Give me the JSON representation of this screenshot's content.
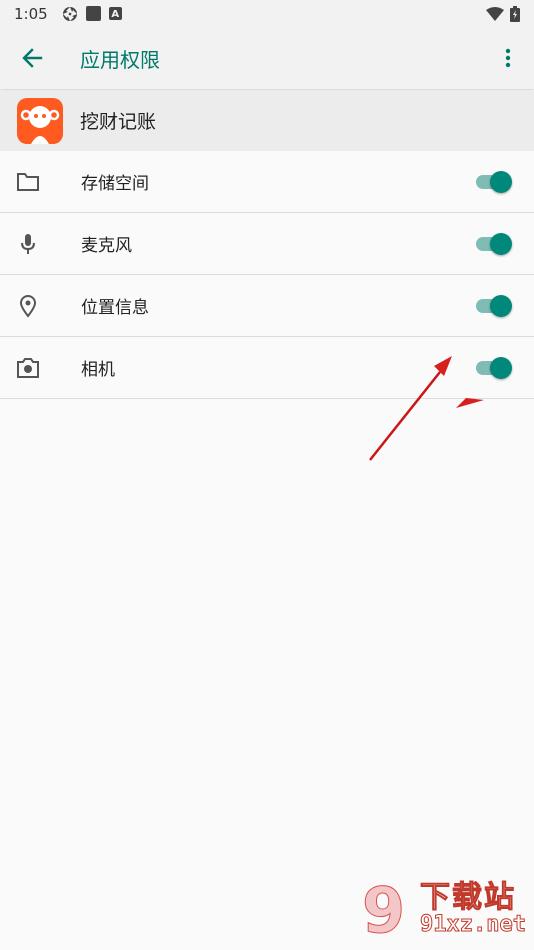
{
  "status_bar": {
    "time": "1:05",
    "icons": [
      "aperture-icon",
      "square-notification-icon",
      "a-notification-icon",
      "wifi-icon",
      "battery-icon"
    ]
  },
  "app_bar": {
    "back_icon": "arrow-back-icon",
    "title": "应用权限",
    "menu_icon": "more-vert-icon"
  },
  "app_info": {
    "icon": "app-logo-icon",
    "name": "挖财记账"
  },
  "permissions": [
    {
      "label": "存储空间",
      "icon": "folder-icon",
      "enabled": true
    },
    {
      "label": "麦克风",
      "icon": "microphone-icon",
      "enabled": true
    },
    {
      "label": "位置信息",
      "icon": "location-pin-icon",
      "enabled": true
    },
    {
      "label": "相机",
      "icon": "camera-icon",
      "enabled": true
    }
  ],
  "colors": {
    "accent": "#00796b",
    "toggle_thumb": "#00897b",
    "toggle_track": "#7fbcb5",
    "app_icon_bg": "#ff5a1f",
    "annotation_arrow": "#d81f1f"
  },
  "watermark": {
    "big": "下载站",
    "small": "91xz.net",
    "logo_glyph": "9"
  }
}
